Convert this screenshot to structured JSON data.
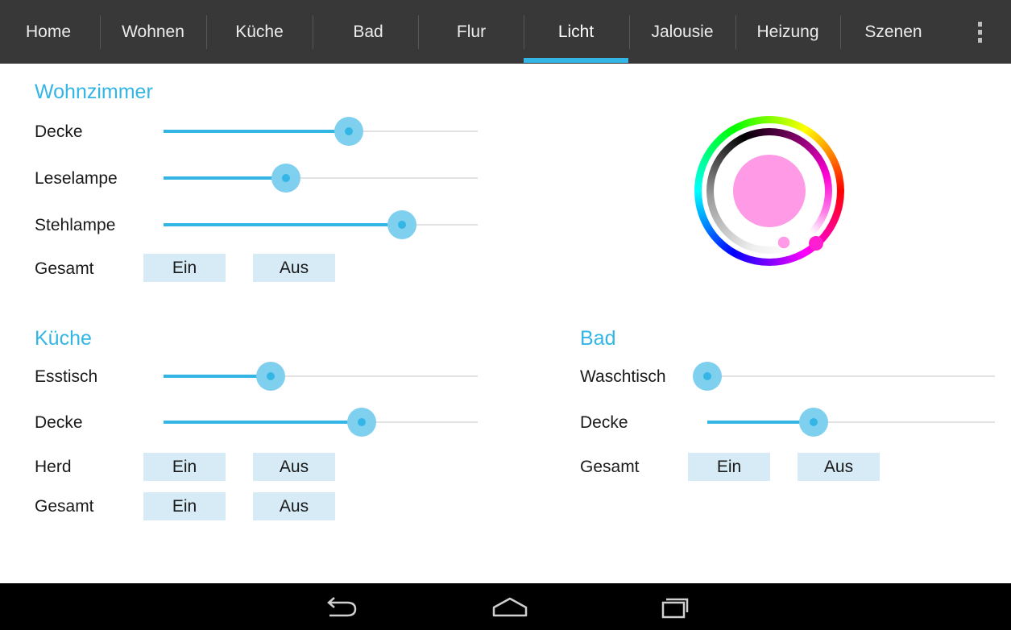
{
  "tabs": [
    {
      "label": "Home"
    },
    {
      "label": "Wohnen"
    },
    {
      "label": "Küche"
    },
    {
      "label": "Bad"
    },
    {
      "label": "Flur"
    },
    {
      "label": "Licht"
    },
    {
      "label": "Jalousie"
    },
    {
      "label": "Heizung"
    },
    {
      "label": "Szenen"
    }
  ],
  "active_tab": "Licht",
  "colors": {
    "accent": "#33b5e5",
    "slider_thumb_halo": "#7fd0ef",
    "tabbar_bg": "#383838",
    "button_bg": "#d6ebf6",
    "selected_color": "#ff9ae6",
    "hue_marker": "#ff1fd0"
  },
  "wohnzimmer": {
    "title": "Wohnzimmer",
    "sliders": [
      {
        "label": "Decke",
        "value": 0.59
      },
      {
        "label": "Leselampe",
        "value": 0.39
      },
      {
        "label": "Stehlampe",
        "value": 0.76
      }
    ],
    "gesamt": {
      "label": "Gesamt",
      "on": "Ein",
      "off": "Aus"
    }
  },
  "kueche": {
    "title": "Küche",
    "sliders": [
      {
        "label": "Esstisch",
        "value": 0.34
      },
      {
        "label": "Decke",
        "value": 0.63
      }
    ],
    "herd": {
      "label": "Herd",
      "on": "Ein",
      "off": "Aus"
    },
    "gesamt": {
      "label": "Gesamt",
      "on": "Ein",
      "off": "Aus"
    }
  },
  "bad": {
    "title": "Bad",
    "sliders": [
      {
        "label": "Waschtisch",
        "value": 0.0
      },
      {
        "label": "Decke",
        "value": 0.37
      }
    ],
    "gesamt": {
      "label": "Gesamt",
      "on": "Ein",
      "off": "Aus"
    }
  },
  "color_picker": {
    "selected_color": "#ff9ae6",
    "hue_degrees": 300,
    "saturation_fraction": 0.85
  },
  "navbar": {
    "icons": [
      "back-icon",
      "home-icon",
      "recent-apps-icon"
    ]
  }
}
